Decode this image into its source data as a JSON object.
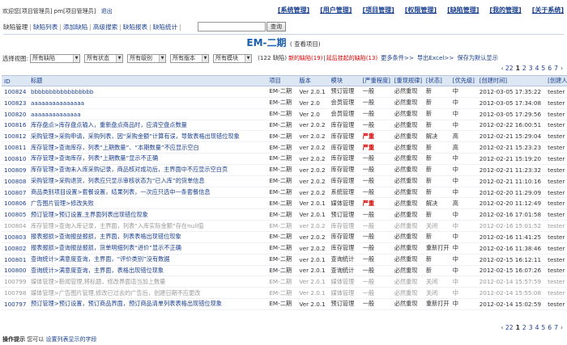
{
  "top": {
    "welcome": "欢迎您[项目管理员] pm[项目管理员]",
    "logout": "退出",
    "menu": [
      "[系统管理]",
      "[用户管理]",
      "[项目管理]",
      "[权限管理]",
      "[缺陷管理]",
      "[我的管理]",
      "[关于系统]"
    ]
  },
  "subnav": {
    "items": [
      "缺陷管理",
      "缺陷列表",
      "添加缺陷",
      "高级搜索",
      "缺陷报表",
      "缺陷统计"
    ],
    "search_placeholder": "",
    "search_button": "查询"
  },
  "title": {
    "name": "EM-二期",
    "view_project": "( 查看项目)"
  },
  "filters": {
    "label": "选择视图:",
    "selects": [
      "所有缺陷",
      "所有状态",
      "所有级别",
      "所有版本",
      "所有模块"
    ],
    "count": "(122 缺陷)",
    "new_bugs": "新的缺陷(19)",
    "delayed_bugs": "延后挂起的缺陷(13)",
    "more": "更多条件>>",
    "export": "导出Excel>>",
    "save_default": "保存为默认显示"
  },
  "pager": {
    "prefix": "‹ 22",
    "pages": [
      "1",
      "2",
      "3",
      "4",
      "5",
      "6",
      "7"
    ],
    "current": "1",
    "suffix": "›"
  },
  "table": {
    "headers": [
      "ID",
      "标题",
      "项目",
      "版本",
      "模块",
      "[严重程度]",
      "[重现规律]",
      "[状态]",
      "[优先级]",
      "[创建时间]",
      "[创建人]"
    ],
    "rows": [
      {
        "id": "100824",
        "title": "bbbbbbbbbbbbbbbbb",
        "project": "EM-二期",
        "version": "Ver 2.0.1",
        "module": "预订管理",
        "severity": "一般",
        "repro": "必然重现",
        "status": "新",
        "priority": "中",
        "created": "2012-03-05 17:35:22",
        "creator": "tester",
        "gray": false,
        "sev_red": false
      },
      {
        "id": "100823",
        "title": "aaaaaaaaaaaaaaa",
        "project": "EM-二期",
        "version": "Ver 2.0",
        "module": "会员管理",
        "severity": "一般",
        "repro": "必然重现",
        "status": "新",
        "priority": "中",
        "created": "2012-03-05 17:34:08",
        "creator": "tester",
        "gray": false,
        "sev_red": false
      },
      {
        "id": "100820",
        "title": "aaaaaaaaaaaaaa",
        "project": "EM-二期",
        "version": "Ver 2.0",
        "module": "会员管理",
        "severity": "一般",
        "repro": "必然重现",
        "status": "新",
        "priority": "中",
        "created": "2012-03-05 17:29:56",
        "creator": "tester",
        "gray": false,
        "sev_red": false
      },
      {
        "id": "100816",
        "title": "库存盘点>库存盘点输入，重新盘点商品时，应清空盘点数量",
        "project": "EM-二期",
        "version": "ver 2.0.2",
        "module": "库存管理",
        "severity": "一般",
        "repro": "必然重现",
        "status": "新",
        "priority": "中",
        "created": "2012-02-22 16:00:51",
        "creator": "tester",
        "gray": false,
        "sev_red": false
      },
      {
        "id": "100812",
        "title": "采购管理>采购申请，采购列表，因“采购金额”计算有误，导致表格出现错位现象",
        "project": "EM-二期",
        "version": "ver 2.0.2",
        "module": "库存管理",
        "severity": "严重",
        "repro": "必然重现",
        "status": "解决",
        "priority": "高",
        "created": "2012-02-21 15:29:04",
        "creator": "tester",
        "gray": false,
        "sev_red": true
      },
      {
        "id": "100811",
        "title": "库存管理>查询库存，列表“上期数量”、“本期数量”不应显示空白",
        "project": "EM-二期",
        "version": "ver 2.0.2",
        "module": "库存管理",
        "severity": "严重",
        "repro": "必然重现",
        "status": "新",
        "priority": "高",
        "created": "2012-02-21 15:23:23",
        "creator": "tester",
        "gray": false,
        "sev_red": true
      },
      {
        "id": "100810",
        "title": "库存管理>查询库存，列表“上期数量”显示不正确",
        "project": "EM-二期",
        "version": "ver 2.0.2",
        "module": "库存管理",
        "severity": "一般",
        "repro": "必然重现",
        "status": "新",
        "priority": "中",
        "created": "2012-02-21 15:19:20",
        "creator": "tester",
        "gray": false,
        "sev_red": false
      },
      {
        "id": "100809",
        "title": "库存管理>查询未入库采购记录，商品核对成功后，主界面中不应显示空白页",
        "project": "EM-二期",
        "version": "ver 2.0.2",
        "module": "库存管理",
        "severity": "一般",
        "repro": "必然重现",
        "status": "新",
        "priority": "中",
        "created": "2012-02-21 11:23:32",
        "creator": "tester",
        "gray": false,
        "sev_red": false
      },
      {
        "id": "100808",
        "title": "采购管理>采购退货，列表应只显示审核状态为“已入库”的货单信息",
        "project": "EM-二期",
        "version": "ver 2.0.2",
        "module": "库存管理",
        "severity": "一般",
        "repro": "必然重现",
        "status": "新",
        "priority": "中",
        "created": "2012-02-21 11:10:16",
        "creator": "tester",
        "gray": false,
        "sev_red": false
      },
      {
        "id": "100807",
        "title": "商品类别项目设置>套餐设置，结果列表，一次应只选中一条套餐信息",
        "project": "EM-二期",
        "version": "ver 2.0.2",
        "module": "系统管理",
        "severity": "一般",
        "repro": "必然重现",
        "status": "新",
        "priority": "中",
        "created": "2012-02-20 11:29:09",
        "creator": "tester",
        "gray": false,
        "sev_red": false
      },
      {
        "id": "100806",
        "title": "广告图片管理>修改失败",
        "project": "EM-二期",
        "version": "Ver 2.0.1",
        "module": "媒体管理",
        "severity": "严重",
        "repro": "必然重现",
        "status": "解决",
        "priority": "高",
        "created": "2012-02-20 11:12:49",
        "creator": "tester",
        "gray": false,
        "sev_red": true
      },
      {
        "id": "100805",
        "title": "预订管理>预订设置,主界面列表出现错位现象",
        "project": "EM-二期",
        "version": "Ver 2.0.1",
        "module": "预订管理",
        "severity": "一般",
        "repro": "必然重现",
        "status": "新",
        "priority": "中",
        "created": "2012-02-16 17:01:58",
        "creator": "tester",
        "gray": false,
        "sev_red": false
      },
      {
        "id": "100804",
        "title": "库存管理>查询入库记录，主界面，列表“入库实际金额”存在null值",
        "project": "EM-二期",
        "version": "ver 2.0.2",
        "module": "库存管理",
        "severity": "一般",
        "repro": "必然重现",
        "status": "关闭",
        "priority": "中",
        "created": "2012-02-16 15:01:52",
        "creator": "tester",
        "gray": true,
        "sev_red": false
      },
      {
        "id": "100803",
        "title": "报表报损>查询报益报损，主界面，列表表格出现错位现象",
        "project": "EM-二期",
        "version": "ver 2.0.2",
        "module": "库存管理",
        "severity": "一般",
        "repro": "必然重现",
        "status": "新",
        "priority": "中",
        "created": "2012-02-16 11:41:25",
        "creator": "tester",
        "gray": false,
        "sev_red": false
      },
      {
        "id": "100802",
        "title": "报表报损>查询报益报损，货单明细列表“进价”显示不正确",
        "project": "EM-二期",
        "version": "ver 2.0.2",
        "module": "库存管理",
        "severity": "一般",
        "repro": "必然重现",
        "status": "重新打开",
        "priority": "中",
        "created": "2012-02-16 11:38:46",
        "creator": "tester",
        "gray": false,
        "sev_red": false
      },
      {
        "id": "100801",
        "title": "查询统计>满意度查询，主界面，“评价类别”没有数据",
        "project": "EM-二期",
        "version": "ver 2.0.1",
        "module": "查询统计",
        "severity": "一般",
        "repro": "必然重现",
        "status": "新",
        "priority": "中",
        "created": "2012-02-15 16:12:11",
        "creator": "tester",
        "gray": false,
        "sev_red": false
      },
      {
        "id": "100800",
        "title": "查询统计>满意度查询，主界面，表格出现错位现象",
        "project": "EM-二期",
        "version": "ver 2.0.1",
        "module": "查询统计",
        "severity": "一般",
        "repro": "必然重现",
        "status": "新",
        "priority": "中",
        "created": "2012-02-15 16:07:26",
        "creator": "tester",
        "gray": false,
        "sev_red": false
      },
      {
        "id": "100799",
        "title": "媒体管理>新闻管理,将标题，修改界面适当加上数量",
        "project": "EM-二期",
        "version": "Ver 2.0.1",
        "module": "媒体管理",
        "severity": "一般",
        "repro": "必然重现",
        "status": "关闭",
        "priority": "中",
        "created": "2012-02-14 15:57:59",
        "creator": "tester",
        "gray": true,
        "sev_red": false
      },
      {
        "id": "100798",
        "title": "媒体管理>广告图片管理,修改已过去的广告后，创建日期不应更改",
        "project": "EM-二期",
        "version": "Ver 2.0.1",
        "module": "媒体管理",
        "severity": "一般",
        "repro": "必然重现",
        "status": "关闭",
        "priority": "中",
        "created": "2012-02-14 15:55:08",
        "creator": "tester",
        "gray": true,
        "sev_red": false
      },
      {
        "id": "100797",
        "title": "预订管理>预订设置，预订商品界面，预订商品清单列表表格出现错位现象",
        "project": "EM-二期",
        "version": "Ver 2.0.1",
        "module": "预订管理",
        "severity": "一般",
        "repro": "必然重现",
        "status": "重新打开",
        "priority": "中",
        "created": "2012-02-14 15:02:59",
        "creator": "tester",
        "gray": false,
        "sev_red": false
      }
    ]
  },
  "footer": {
    "label": "操作提示",
    "text": "您可以",
    "link": "设置列表显示的字段"
  }
}
